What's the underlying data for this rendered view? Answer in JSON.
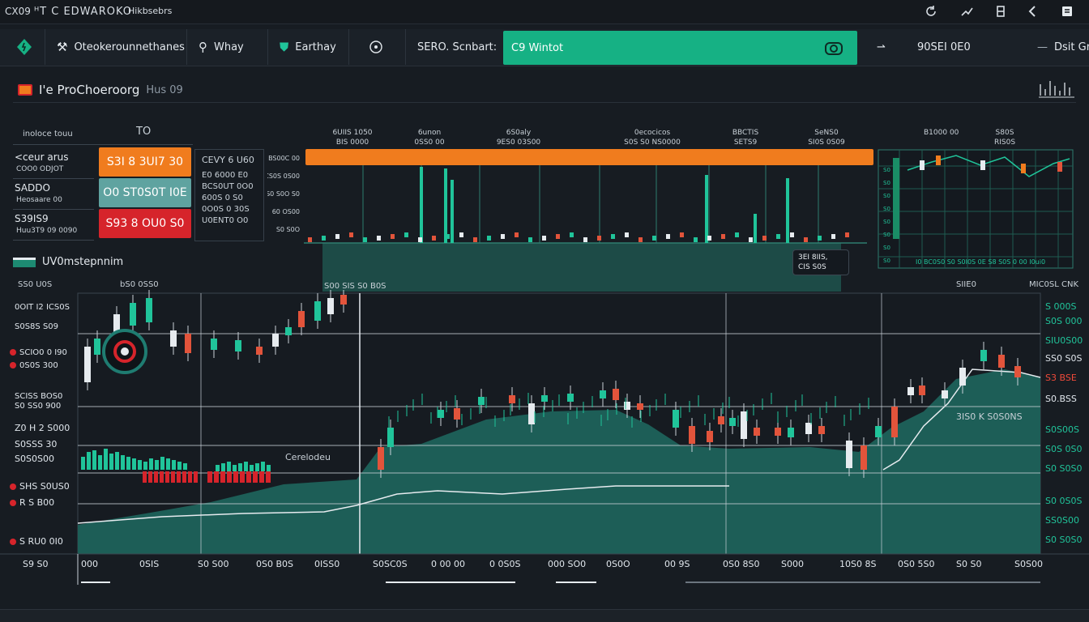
{
  "topbar": {
    "left_label": "CX09",
    "title": "ᴴT C EDWAROKO",
    "subtitle": "Hikbsebrs"
  },
  "toolbar": {
    "item1": "Oteokerounnethanes",
    "item2": "Whay",
    "item3": "Earthay",
    "item4": "SERO. Scnbart:",
    "active": "C9 Wintot",
    "item5": "90SEI 0E0",
    "right_label": "Dsit Gr"
  },
  "panel": {
    "title": "I'e ProChoeroorg",
    "subtitle": "Hus 09"
  },
  "top_section": {
    "left_caption": "inoloce touu",
    "to_label": "TO",
    "rows": [
      {
        "label": "<ceur arus",
        "sub": "COO0 ODJOT",
        "value": "S3I 8 3UI7 30",
        "color": "#f07c1e"
      },
      {
        "label": "SADDO",
        "sub": "Heosaare 00",
        "value": "O0 ST0S0T I0E",
        "color": "#5fa3a0"
      },
      {
        "label": "S39IS9",
        "sub": "Huu3T9 09 0090",
        "value": "S93 8 OU0 S0",
        "color": "#d6242b"
      }
    ],
    "orderbook": [
      "CEVY 6 U60",
      "E0 6000 E0",
      "BCS0UT 0O0",
      "600S 0 S0",
      "0O0S 0 30S",
      "U0ENT0 O0"
    ],
    "col_headers": [
      "6UIIS 1050\nBIS 0000",
      "6unon\n0SS0 00",
      "6S0aly\n9ES0 03S00",
      "0ecocicos\nS0S S0 NS0000",
      "BBCTIS\nSETS9",
      "SeNS0\nSI0S 0S09"
    ],
    "mid_labels": [
      "BS00C 00",
      "CS0S 0S00",
      "US0 S0O S0",
      "60 OS00",
      "S0 S0O"
    ],
    "right_header": "B1000 00",
    "right_header2": "S80S\nRIS0S",
    "callout": "3EI 8IIS,\nCIS S0S",
    "green_strip": "I0 BC0S0 S0 S0I0S 0E S8 S0S 0 00 I0ui0"
  },
  "section2": {
    "title": "UV0mstepnnim",
    "col_a": "SS0 U0S",
    "col_b": "bS0 0SS0",
    "col_c": "S00 SIS S0 B0S",
    "right_a": "SIIE0",
    "right_b": "MIC0SL CNK"
  },
  "left_axis": [
    {
      "text": "0OIT I2 ICS0S",
      "dot": ""
    },
    {
      "text": "S0S8S S09",
      "dot": ""
    },
    {
      "text": "SCIO0 0 I90",
      "dot": "#d6242b"
    },
    {
      "text": "0S0S 300",
      "dot": "#d6242b"
    },
    {
      "text": "SCISS BOS0",
      "dot": ""
    },
    {
      "text": "S0 SS0 900",
      "dot": ""
    },
    {
      "text": "Z0 H 2 S000",
      "dot": ""
    },
    {
      "text": "S0SSS 30",
      "dot": ""
    },
    {
      "text": "S0S0S00",
      "dot": ""
    },
    {
      "text": "SHS S0US0",
      "dot": "#d6242b"
    },
    {
      "text": "R S B00",
      "dot": "#d6242b"
    },
    {
      "text": "S RU0 0I0",
      "dot": "#d6242b"
    }
  ],
  "right_axis": [
    {
      "text": "S 000S",
      "color": "#20c49a"
    },
    {
      "text": "S0S 000",
      "color": "#20c49a"
    },
    {
      "text": "SIU0S00",
      "color": "#20c49a"
    },
    {
      "text": "SS0 S0S",
      "color": "#e0e6ec"
    },
    {
      "text": "S3 BSE",
      "color": "#f04a3a"
    },
    {
      "text": "S0.BSS",
      "color": "#e0e6ec"
    },
    {
      "text": "S0S00S",
      "color": "#20c49a"
    },
    {
      "text": "S0S 0S0",
      "color": "#20c49a"
    },
    {
      "text": "S0 S0S0",
      "color": "#20c49a"
    },
    {
      "text": "S0 0S0S",
      "color": "#20c49a"
    },
    {
      "text": "SS0S00",
      "color": "#20c49a"
    },
    {
      "text": "S0 S0S0",
      "color": "#20c49a"
    }
  ],
  "chart_annotations": {
    "mid": "Cerelodeu",
    "right": "3IS0 K S0S0NS"
  },
  "bottom_axis": [
    "S9 S0",
    "000",
    "0SIS",
    "S0 S00",
    "0S0 B0S",
    "0ISS0",
    "S0SC0S",
    "0 00 00",
    "0 0S0S",
    "000 SO0",
    "0S0O",
    "00 9S",
    "0S0 8S0",
    "S000",
    "10S0 8S",
    "0S0 5S0",
    "S0 S0",
    "S0S00"
  ],
  "colors": {
    "accent": "#16b184",
    "orange": "#f07c1e",
    "red": "#d6242b",
    "teal": "#1d5e57",
    "bg": "#171c22"
  }
}
